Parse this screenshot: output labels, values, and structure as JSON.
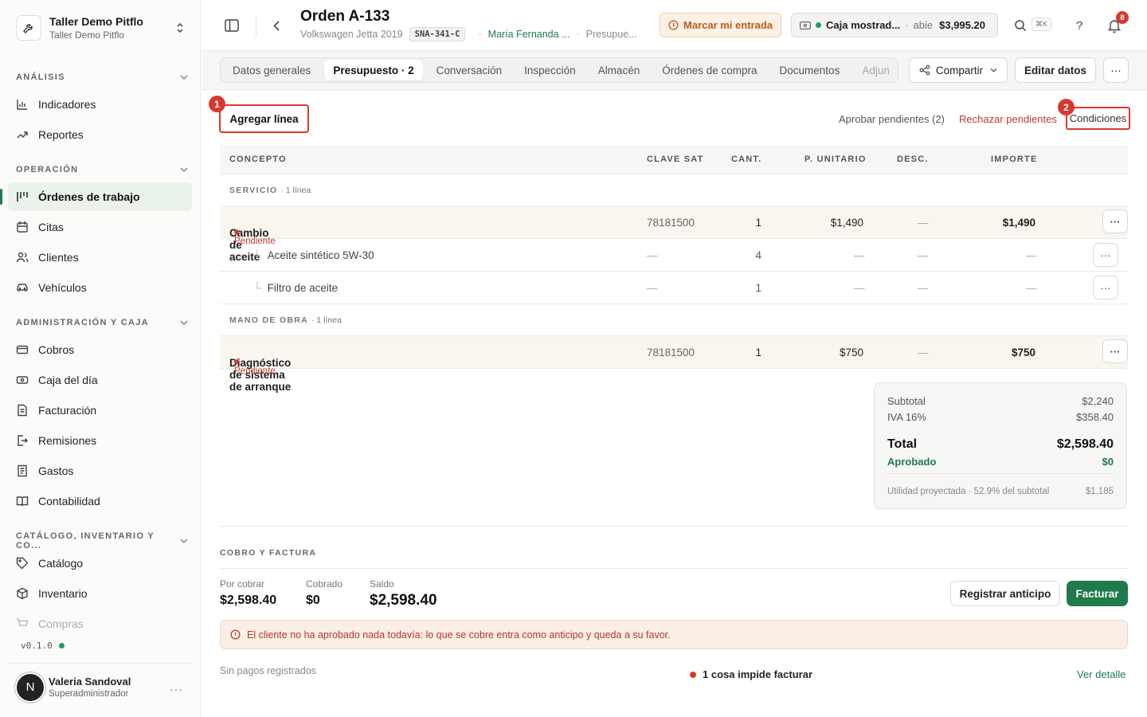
{
  "sidebar": {
    "org_name": "Taller Demo Pitflo",
    "org_sub": "Taller Demo Pitflo",
    "sections": [
      {
        "title": "ANÁLISIS"
      },
      {
        "title": "OPERACIÓN"
      },
      {
        "title": "ADMINISTRACIÓN Y CAJA"
      },
      {
        "title": "CATÁLOGO, INVENTARIO Y CO..."
      }
    ],
    "items": [
      {
        "label": "Indicadores",
        "icon": "bar-chart-icon"
      },
      {
        "label": "Reportes",
        "icon": "trend-icon"
      },
      {
        "label": "Órdenes de trabajo",
        "icon": "kanban-icon"
      },
      {
        "label": "Citas",
        "icon": "calendar-icon"
      },
      {
        "label": "Clientes",
        "icon": "users-icon"
      },
      {
        "label": "Vehículos",
        "icon": "car-icon"
      },
      {
        "label": "Cobros",
        "icon": "card-icon"
      },
      {
        "label": "Caja del día",
        "icon": "cash-icon"
      },
      {
        "label": "Facturación",
        "icon": "invoice-icon"
      },
      {
        "label": "Remisiones",
        "icon": "export-icon"
      },
      {
        "label": "Gastos",
        "icon": "receipt-icon"
      },
      {
        "label": "Contabilidad",
        "icon": "book-icon"
      },
      {
        "label": "Catálogo",
        "icon": "tag-icon"
      },
      {
        "label": "Inventario",
        "icon": "box-icon"
      },
      {
        "label": "Compras",
        "icon": "cart-icon"
      }
    ],
    "version": "v0.1.0",
    "user_initial": "N",
    "user_name": "Valeria Sandoval",
    "user_role": "Superadministrador"
  },
  "header": {
    "title": "Orden A-133",
    "vehicle": "Volkswagen Jetta 2019",
    "plate": "SNA-341-C",
    "customer": "María Fernanda ...",
    "stage": "Presupue...",
    "checkin_label": "Marcar mi entrada",
    "cash_name": "Caja mostrad...",
    "cash_state": "abie",
    "cash_amount": "$3,995.20",
    "kbd": "⌘K",
    "help": "?",
    "notifications": "8"
  },
  "tabs": [
    "Datos generales",
    "Presupuesto · 2",
    "Conversación",
    "Inspección",
    "Almacén",
    "Órdenes de compra",
    "Documentos",
    "Adjun"
  ],
  "toolbar": {
    "share": "Compartir",
    "edit": "Editar datos"
  },
  "budget": {
    "add_line": "Agregar línea",
    "marker_1": "1",
    "marker_2": "2",
    "approve": "Aprobar pendientes (2)",
    "reject": "Rechazar pendientes",
    "conditions": "Condiciones",
    "columns": [
      "CONCEPTO",
      "CLAVE SAT",
      "CANT.",
      "P. UNITARIO",
      "DESC.",
      "IMPORTE"
    ],
    "groups": [
      {
        "name": "SERVICIO",
        "count": "· 1 línea"
      },
      {
        "name": "MANO DE OBRA",
        "count": "· 1 línea"
      }
    ],
    "rows": [
      {
        "concept": "Cambio de aceite",
        "status": "Pendiente",
        "sat": "78181500",
        "qty": "1",
        "unit": "$1,490",
        "disc": "—",
        "total": "$1,490"
      },
      {
        "concept": "Aceite sintético 5W-30",
        "sat": "—",
        "qty": "4",
        "unit": "—",
        "disc": "—",
        "total": "—"
      },
      {
        "concept": "Filtro de aceite",
        "sat": "—",
        "qty": "1",
        "unit": "—",
        "disc": "—",
        "total": "—"
      },
      {
        "concept": "Diagnóstico de sistema de arranque",
        "status": "Pendiente",
        "sat": "78181500",
        "qty": "1",
        "unit": "$750",
        "disc": "—",
        "total": "$750"
      }
    ],
    "row_menu": "···"
  },
  "totals": {
    "subtotal_label": "Subtotal",
    "subtotal": "$2,240",
    "iva_label": "IVA 16%",
    "iva": "$358.40",
    "total_label": "Total",
    "total": "$2,598.40",
    "approved_label": "Aprobado",
    "approved": "$0",
    "profit_label": "Utilidad proyectada · 52.9% del subtotal",
    "profit": "$1,185"
  },
  "payment": {
    "heading": "COBRO Y FACTURA",
    "due_label": "Por cobrar",
    "due": "$2,598.40",
    "paid_label": "Cobrado",
    "paid": "$0",
    "balance_label": "Saldo",
    "balance": "$2,598.40",
    "advance_btn": "Registrar anticipo",
    "invoice_btn": "Facturar",
    "alert": "El cliente no ha aprobado nada todavía: lo que se cobre entra como anticipo y queda a su favor.",
    "no_payments": "Sin pagos registrados",
    "blocker": "1 cosa impide facturar",
    "detail": "Ver detalle"
  }
}
